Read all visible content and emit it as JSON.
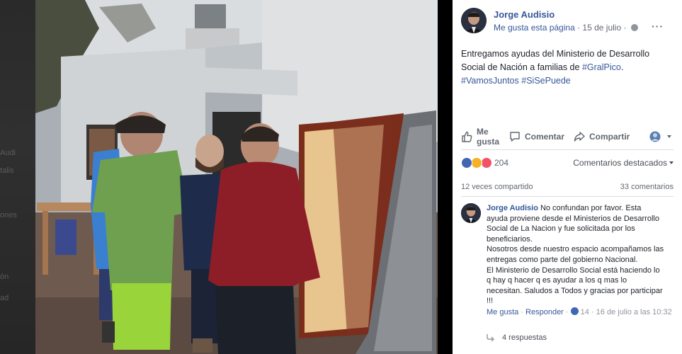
{
  "background": {
    "ghost_texts": [
      "Audi",
      "talis",
      "ones",
      "ón",
      "ad"
    ]
  },
  "post": {
    "author": "Jorge Audisio",
    "like_page": "Me gusta esta página",
    "separator": " · ",
    "date": "15 de julio",
    "date_separator": " · ",
    "more": "···",
    "text_prefix": "Entregamos ayudas del Ministerio de Desarrollo Social de Nación a familias de ",
    "tag_gralpico": "#GralPico",
    "text_period": ".",
    "tag_vamos": "#VamosJuntos",
    "tag_sisepuede": "#SiSePuede"
  },
  "actions": {
    "like_line1": "Me",
    "like_line2": "gusta",
    "comment": "Comentar",
    "share": "Compartir"
  },
  "reactions": {
    "count": "204",
    "featured": "Comentarios destacados",
    "colors": {
      "like": "#4267b2",
      "wow": "#f7b125",
      "love": "#f25268"
    }
  },
  "stats": {
    "shares": "12 veces compartido",
    "comments": "33 comentarios"
  },
  "comment": {
    "author": "Jorge Audisio",
    "lines": [
      "No confundan por favor. Esta",
      "ayuda proviene desde el Ministerios de Desarrollo",
      "Social de La Nacion y fue solicitada por los",
      "beneficiarios.",
      "Nosotros desde nuestro espacio acompañamos las",
      "entregas como parte del gobierno Nacional.",
      "El Ministerio de Desarrollo Social está haciendo lo",
      "q hay q hacer q es ayudar a los q mas lo",
      "necesitan. Saludos a Todos y gracias por participar",
      "!!!"
    ],
    "like_action": "Me gusta",
    "dot1": " · ",
    "reply_action": "Responder",
    "dot2": " · ",
    "likes": "14",
    "dot3": " · ",
    "timestamp": "16 de julio a las 10:32",
    "replies": "4 respuestas"
  }
}
